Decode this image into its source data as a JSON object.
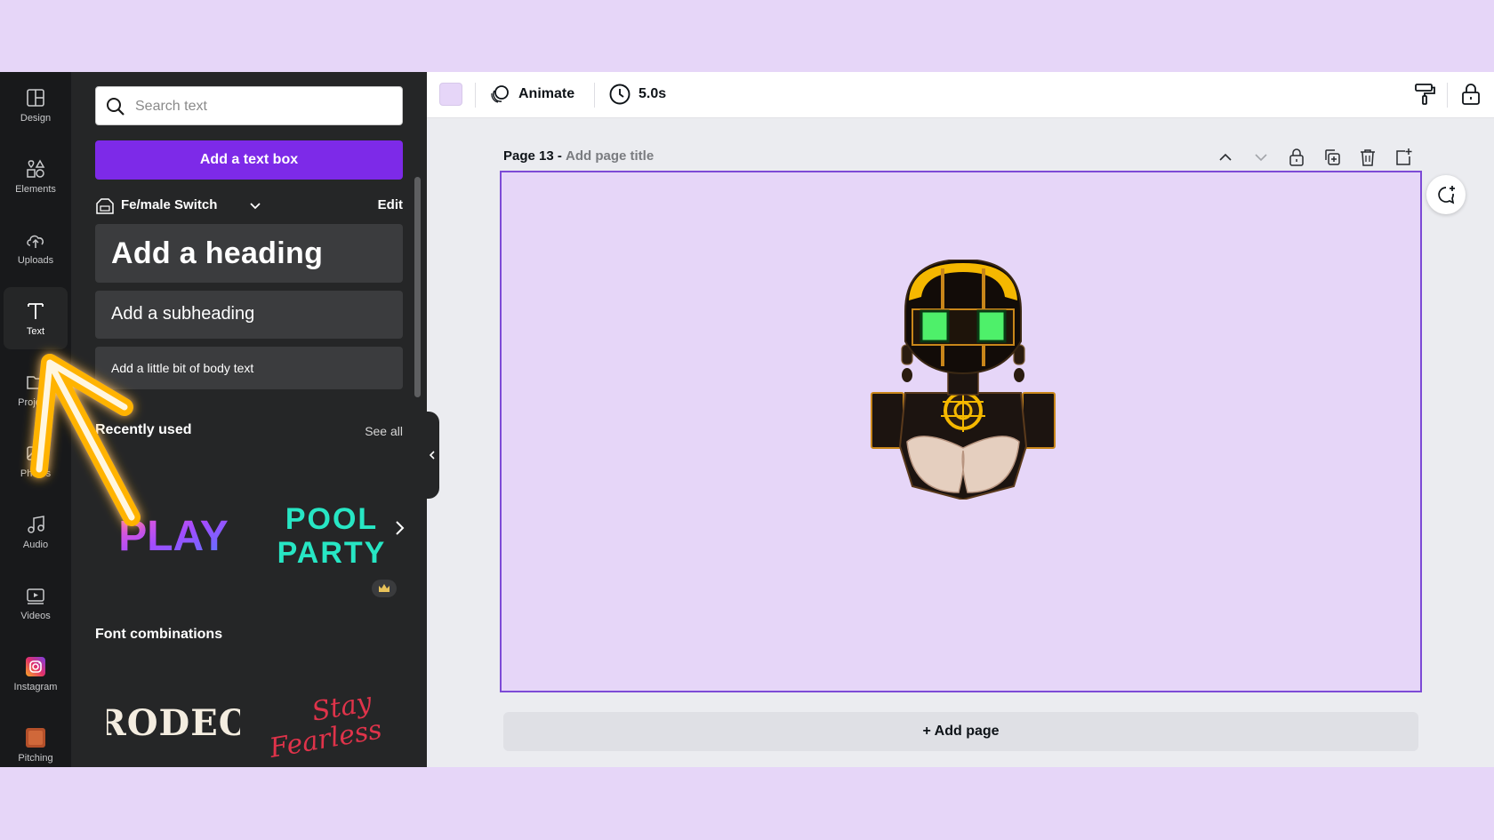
{
  "sidebar": {
    "items": [
      {
        "label": "Design",
        "icon": "design-icon"
      },
      {
        "label": "Elements",
        "icon": "elements-icon"
      },
      {
        "label": "Uploads",
        "icon": "uploads-icon"
      },
      {
        "label": "Text",
        "icon": "text-icon",
        "active": true
      },
      {
        "label": "Projects",
        "icon": "projects-icon"
      },
      {
        "label": "Photos",
        "icon": "photos-icon"
      },
      {
        "label": "Audio",
        "icon": "audio-icon"
      },
      {
        "label": "Videos",
        "icon": "videos-icon"
      },
      {
        "label": "Instagram",
        "icon": "instagram-icon"
      },
      {
        "label": "Pitching",
        "icon": "pitching-icon"
      }
    ]
  },
  "panel": {
    "search_placeholder": "Search text",
    "add_textbox_label": "Add a text box",
    "brand_kit_name": "Fe/male Switch",
    "edit_label": "Edit",
    "heading_label": "Add a heading",
    "subheading_label": "Add a subheading",
    "body_label": "Add a little bit of body text",
    "recently_used_title": "Recently used",
    "see_all_label": "See all",
    "recent_tiles": [
      "PLAY",
      "POOL",
      "PARTY"
    ],
    "font_combinations_title": "Font combinations",
    "combo_tiles": [
      "RODEO",
      "Stay",
      "Fearless"
    ]
  },
  "toolbar": {
    "page_color": "#e6d6f8",
    "animate_label": "Animate",
    "duration_label": "5.0s"
  },
  "page": {
    "number_label": "Page 13 -",
    "title_placeholder": "Add page title",
    "add_page_label": "+ Add page"
  },
  "colors": {
    "accent": "#7d2ae8",
    "canvas_background": "#e6d6f8",
    "panel_background": "#252627",
    "rail_background": "#18191b",
    "highlight_arrow": "#ffb300"
  }
}
